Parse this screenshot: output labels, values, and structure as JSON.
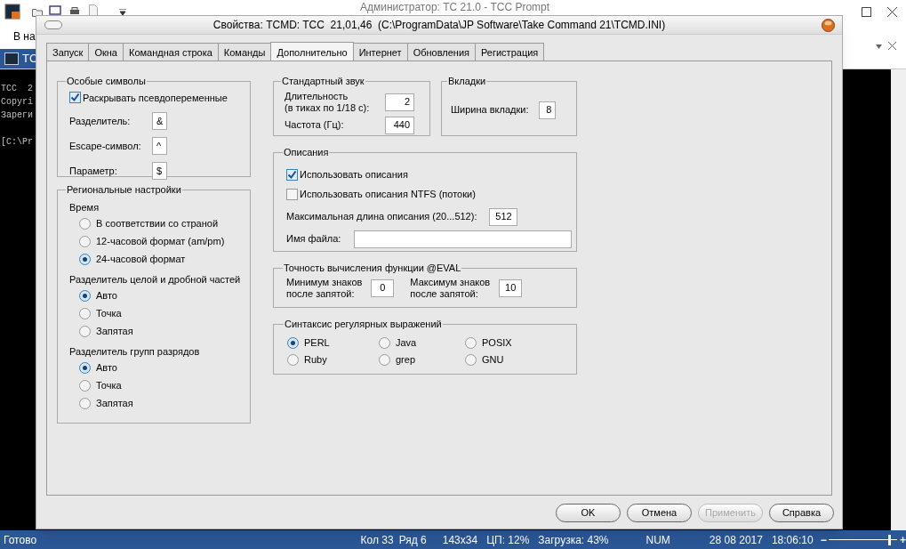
{
  "background_window": {
    "title": "Администратор: TC 21.0 - TCC Prompt",
    "ribbon_text": "В на",
    "tab": "TC",
    "console_lines": [
      "TCC  2",
      "Copyri",
      "Зареги",
      "[C:\\Pr"
    ]
  },
  "dialog": {
    "title": "Свойства: TCMD: TCC  21,01,46  (C:\\ProgramData\\JP Software\\Take Command 21\\TCMD.INI)",
    "tabs": [
      {
        "label": "Запуск",
        "selected": false
      },
      {
        "label": "Окна",
        "selected": false
      },
      {
        "label": "Командная строка",
        "selected": false
      },
      {
        "label": "Команды",
        "selected": false
      },
      {
        "label": "Дополнительно",
        "selected": true
      },
      {
        "label": "Интернет",
        "selected": false
      },
      {
        "label": "Обновления",
        "selected": false
      },
      {
        "label": "Регистрация",
        "selected": false
      }
    ],
    "special_chars": {
      "title": "Особые символы",
      "expand": {
        "label": "Раскрывать псевдопеременные",
        "checked": true
      },
      "fields": [
        {
          "label": "Разделитель:",
          "value": "&"
        },
        {
          "label": "Escape-символ:",
          "value": "^"
        },
        {
          "label": "Параметр:",
          "value": "$"
        }
      ]
    },
    "regional": {
      "title": "Региональные настройки",
      "sections": [
        {
          "heading": "Время",
          "options": [
            {
              "label": "В соответствии со страной",
              "selected": false
            },
            {
              "label": "12-часовой формат (am/pm)",
              "selected": false
            },
            {
              "label": "24-часовой формат",
              "selected": true
            }
          ]
        },
        {
          "heading": "Разделитель целой и дробной частей",
          "options": [
            {
              "label": "Авто",
              "selected": true
            },
            {
              "label": "Точка",
              "selected": false
            },
            {
              "label": "Запятая",
              "selected": false
            }
          ]
        },
        {
          "heading": "Разделитель групп разрядов",
          "options": [
            {
              "label": "Авто",
              "selected": true
            },
            {
              "label": "Точка",
              "selected": false
            },
            {
              "label": "Запятая",
              "selected": false
            }
          ]
        }
      ]
    },
    "sound": {
      "title": "Стандартный звук",
      "fields": [
        {
          "label": "Длительность\n(в тиках по 1/18 с):",
          "value": "2"
        },
        {
          "label": "Частота (Гц):",
          "value": "440"
        }
      ]
    },
    "tabs_group": {
      "title": "Вкладки",
      "fields": [
        {
          "label": "Ширина вкладки:",
          "value": "8"
        }
      ]
    },
    "descriptions": {
      "title": "Описания",
      "checkboxes": [
        {
          "label": "Использовать описания",
          "checked": true
        },
        {
          "label": "Использовать описания NTFS (потоки)",
          "checked": false
        }
      ],
      "max_length": {
        "label": "Максимальная длина описания (20...512):",
        "value": "512"
      },
      "file_name": {
        "label": "Имя файла:"
      }
    },
    "eval": {
      "title": "Точность вычисления функции @EVAL",
      "fields": [
        {
          "label": "Минимум знаков\nпосле запятой:",
          "value": "0"
        },
        {
          "label": "Максимум знаков\nпосле запятой:",
          "value": "10"
        }
      ]
    },
    "regex": {
      "title": "Синтаксис регулярных выражений",
      "options": [
        {
          "label": "PERL",
          "selected": true
        },
        {
          "label": "Ruby",
          "selected": false
        },
        {
          "label": "Java",
          "selected": false
        },
        {
          "label": "grep",
          "selected": false
        },
        {
          "label": "POSIX",
          "selected": false
        },
        {
          "label": "GNU",
          "selected": false
        }
      ]
    },
    "buttons": [
      {
        "label": "OK",
        "disabled": false
      },
      {
        "label": "Отмена",
        "disabled": false
      },
      {
        "label": "Применить",
        "disabled": true
      },
      {
        "label": "Справка",
        "disabled": false
      }
    ]
  },
  "status_bar": {
    "left": "Готово",
    "items": [
      "Кол 33",
      "Ряд 6",
      "143x34",
      "ЦП: 12%",
      "Загрузка: 43%",
      "NUM",
      "28 08 2017",
      "18:06:10"
    ],
    "zoom": {
      "minus": "−",
      "plus": "+",
      "level": 0.88
    }
  }
}
